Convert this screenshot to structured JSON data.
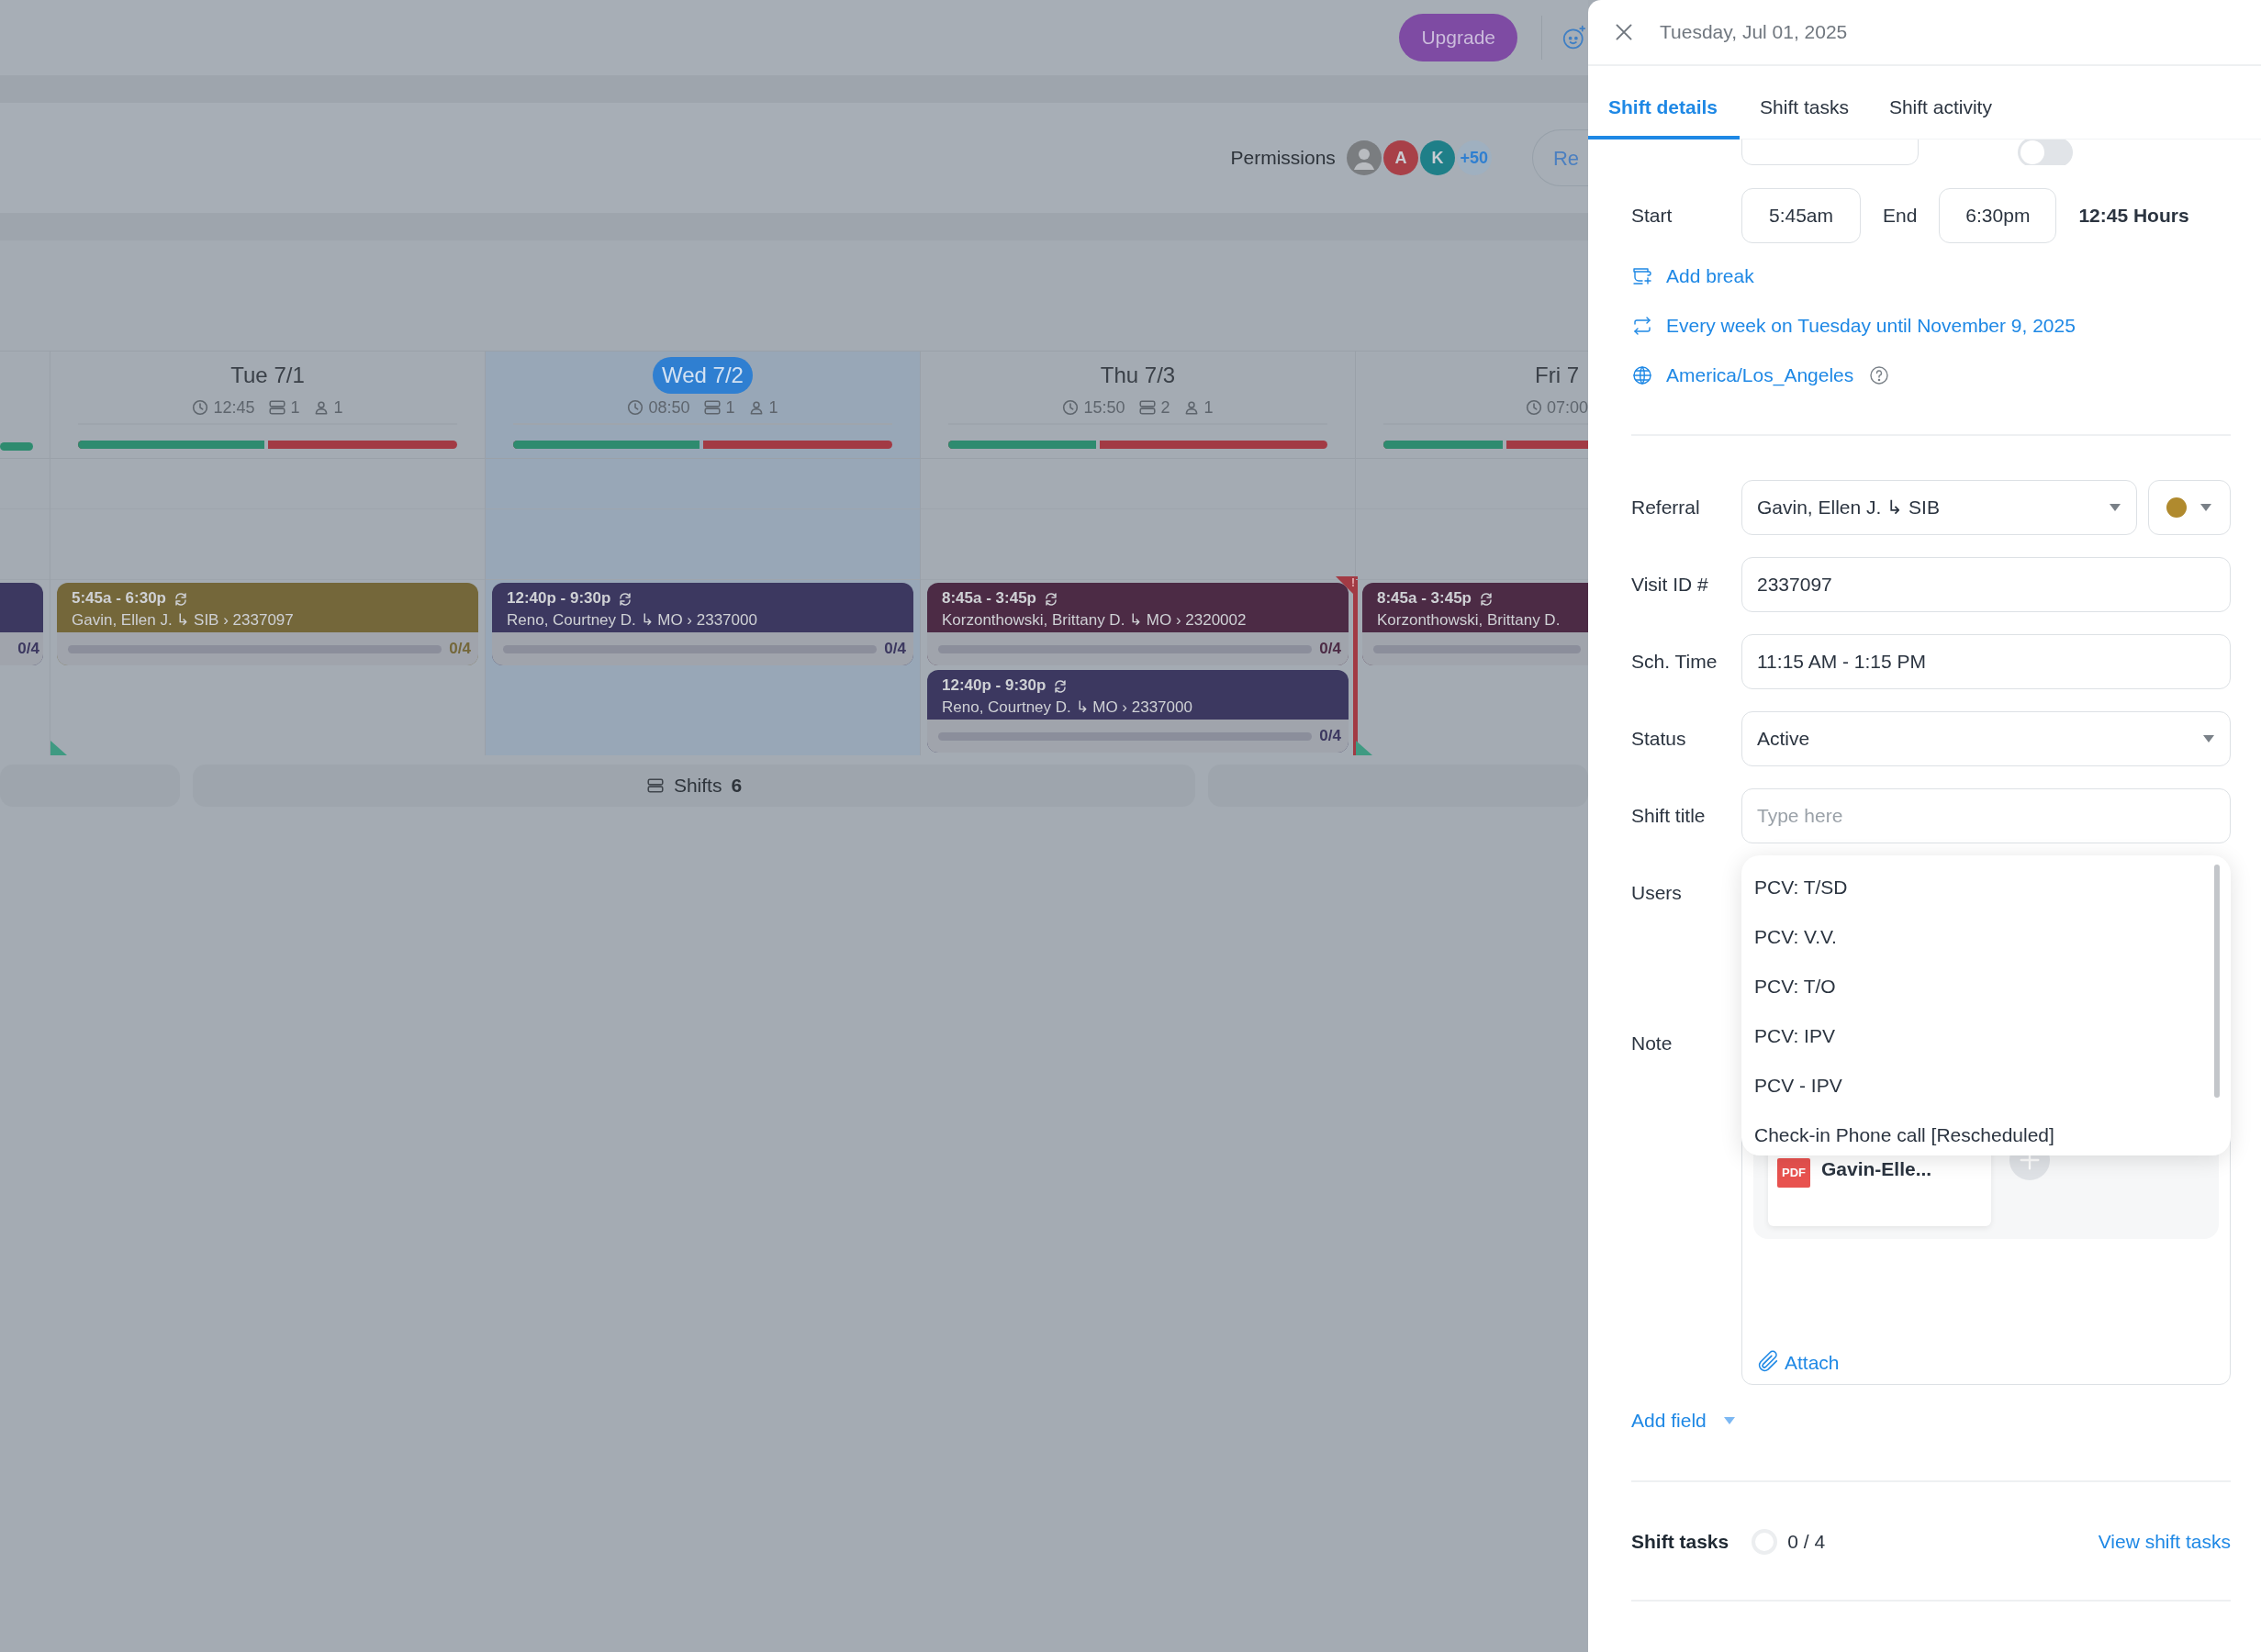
{
  "topbar": {
    "upgrade": "Upgrade"
  },
  "toolbar": {
    "permissions_label": "Permissions",
    "avatars": [
      {
        "kind": "photo"
      },
      {
        "kind": "initial",
        "text": "A",
        "color": "#a84048"
      },
      {
        "kind": "initial",
        "text": "K",
        "color": "#1f7f88"
      },
      {
        "kind": "count",
        "text": "+50"
      }
    ],
    "button": "Re"
  },
  "calendar": {
    "days": [
      {
        "kind": "partial",
        "selected": false,
        "level": 1,
        "shifts": [
          {
            "color": "#3c3860",
            "tasks": "0/4"
          }
        ]
      },
      {
        "kind": "day",
        "label": "Tue 7/1",
        "selected": false,
        "hours": "12:45",
        "shifts_count": "1",
        "users_count": "1",
        "level": 0.5,
        "shifts": [
          {
            "time": "5:45a - 6:30p",
            "line": "Gavin, Ellen J. ↳ SIB › 2337097",
            "tasks": "0/4",
            "level": 0,
            "color": "#74673a"
          }
        ]
      },
      {
        "kind": "day",
        "label": "Wed 7/2",
        "selected": true,
        "hours": "08:50",
        "shifts_count": "1",
        "users_count": "1",
        "level": 0.5,
        "shifts": [
          {
            "time": "12:40p - 9:30p",
            "line": "Reno, Courtney D. ↳ MO › 2337000",
            "tasks": "0/4",
            "level": 0,
            "color": "#3c3860"
          }
        ]
      },
      {
        "kind": "day",
        "label": "Thu 7/3",
        "selected": false,
        "hours": "15:50",
        "shifts_count": "2",
        "users_count": "1",
        "level": 0.4,
        "alert": "!",
        "shifts": [
          {
            "time": "8:45a - 3:45p",
            "line": "Korzonthowski, Brittany D. ↳ MO › 2320002",
            "tasks": "0/4",
            "level": 0,
            "color": "#4c2b45"
          },
          {
            "time": "12:40p - 9:30p",
            "line": "Reno, Courtney D. ↳ MO › 2337000",
            "tasks": "0/4",
            "level": 0,
            "color": "#3c3860"
          }
        ]
      },
      {
        "kind": "cut",
        "label": "Fri 7",
        "selected": false,
        "hours": "07:00",
        "level": 0.6,
        "shifts": [
          {
            "time": "8:45a - 3:45p",
            "line": "Korzonthowski, Brittany D.",
            "level": 0,
            "color": "#4c2b45"
          }
        ]
      }
    ],
    "footer": {
      "label": "Shifts",
      "count": "6"
    }
  },
  "panel": {
    "title": "Tuesday, Jul 01, 2025",
    "tabs": [
      {
        "label": "Shift details",
        "selected": true
      },
      {
        "label": "Shift tasks",
        "selected": false
      },
      {
        "label": "Shift activity",
        "selected": false
      }
    ],
    "all_day": {
      "on": false
    },
    "start_label": "Start",
    "start": "5:45am",
    "end_label": "End",
    "end": "6:30pm",
    "duration": "12:45 Hours",
    "links": [
      {
        "kind": "break",
        "text": "Add break"
      },
      {
        "kind": "repeat",
        "text": "Every week on Tuesday until November 9, 2025"
      },
      {
        "kind": "timezone",
        "text": "America/Los_Angeles"
      }
    ],
    "fields": [
      {
        "kind": "referral",
        "label": "Referral",
        "value": "Gavin, Ellen J. ↳ SIB",
        "color": "#b08a2e"
      },
      {
        "kind": "text",
        "label": "Visit ID #",
        "value": "2337097"
      },
      {
        "kind": "text",
        "label": "Sch. Time",
        "value": "11:15 AM - 1:15 PM"
      },
      {
        "kind": "select",
        "label": "Status",
        "value": "Active"
      },
      {
        "kind": "text",
        "label": "Shift title",
        "placeholder": "Type here"
      },
      {
        "kind": "users",
        "label": "Users"
      },
      {
        "kind": "note",
        "label": "Note",
        "file_type": "PDF",
        "attachment": "Gavin-Elle...",
        "attach": "Attach"
      }
    ],
    "dropdown": {
      "options": [
        "PCV: T/SD",
        "PCV: V.V.",
        "PCV: T/O",
        "PCV: IPV",
        "PCV - IPV",
        "Check-in Phone call [Rescheduled]"
      ]
    },
    "add_field": "Add field",
    "tasks": {
      "label": "Shift tasks",
      "count": "0 / 4",
      "link": "View shift tasks"
    }
  }
}
